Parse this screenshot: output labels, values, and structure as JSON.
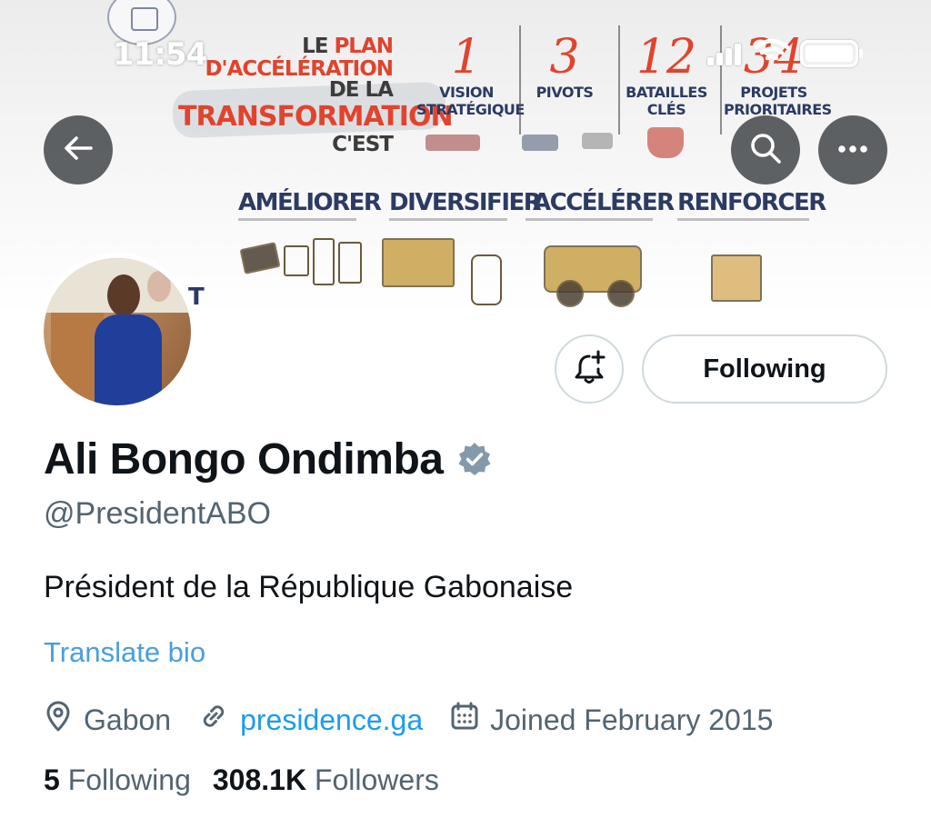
{
  "status_bar": {
    "time": "11:54"
  },
  "banner": {
    "title": {
      "line1_dark": "LE ",
      "line1_red": "PLAN",
      "line2_red": "D'ACCÉLÉRATION",
      "line2_dark": " DE LA",
      "line3": "TRANSFORMATION",
      "line4": "C'EST"
    },
    "pillars": [
      {
        "num": "1",
        "label_1": "VISION",
        "label_2": "STRATÉGIQUE"
      },
      {
        "num": "3",
        "label_1": "PIVOTS",
        "label_2": ""
      },
      {
        "num": "12",
        "label_1": "BATAILLES",
        "label_2": "CLÉS"
      },
      {
        "num": "34",
        "label_1": "PROJETS",
        "label_2": "PRIORITAIRES"
      }
    ],
    "actions": [
      "AMÉLIORER",
      "DIVERSIFIER",
      "ACCÉLÉRER",
      "RENFORCER"
    ],
    "fragment": "T"
  },
  "nav": {
    "back_icon": "arrow-left-icon",
    "search_icon": "search-icon",
    "more_icon": "more-horizontal-icon"
  },
  "profile": {
    "name": "Ali Bongo Ondimba",
    "handle": "@PresidentABO",
    "bio": "Président de la République Gabonaise",
    "translate_label": "Translate bio",
    "location": "Gabon",
    "website": "presidence.ga",
    "joined": "Joined February 2015",
    "following_count": "5",
    "following_label": "Following",
    "followers_count": "308.1K",
    "followers_label": "Followers",
    "verified_color": "#829aab"
  },
  "actions": {
    "follow_label": "Following",
    "notify_icon": "bell-plus-icon"
  },
  "colors": {
    "link": "#1d9bf0",
    "translate": "#4a9edb",
    "muted": "#536471",
    "banner_red": "#e0442d",
    "banner_navy": "#2b3b63"
  }
}
